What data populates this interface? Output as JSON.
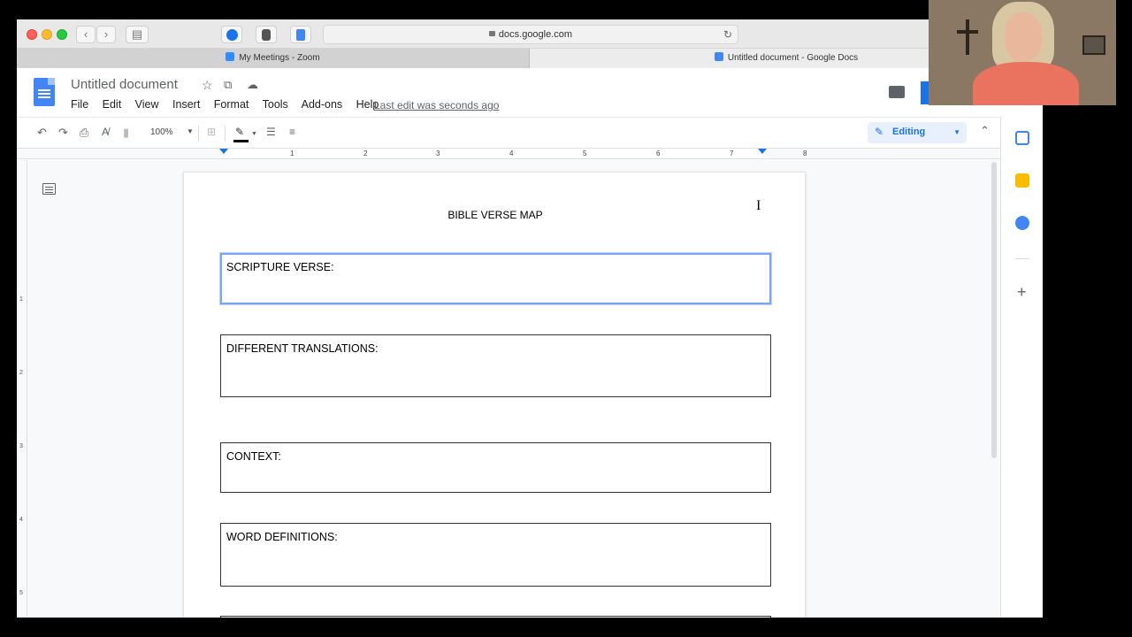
{
  "browser": {
    "url": "docs.google.com",
    "tabs": [
      {
        "label": "My Meetings - Zoom"
      },
      {
        "label": "Untitled document - Google Docs"
      }
    ]
  },
  "docs": {
    "title": "Untitled document",
    "menu": [
      "File",
      "Edit",
      "View",
      "Insert",
      "Format",
      "Tools",
      "Add-ons",
      "Help"
    ],
    "last_edit": "Last edit was seconds ago",
    "zoom": "100%",
    "mode": "Editing",
    "ruler_numbers": [
      "1",
      "2",
      "3",
      "4",
      "5",
      "6",
      "7",
      "8"
    ],
    "vruler_numbers": [
      "1",
      "2",
      "3",
      "4",
      "5"
    ]
  },
  "document": {
    "heading": "BIBLE VERSE MAP",
    "boxes": [
      {
        "label": "SCRIPTURE VERSE:"
      },
      {
        "label": "DIFFERENT TRANSLATIONS:"
      },
      {
        "label": "CONTEXT:"
      },
      {
        "label": "WORD DEFINITIONS:"
      }
    ]
  },
  "icons": {
    "back": "chevron-left-icon",
    "forward": "chevron-right-icon",
    "sidebar": "sidebar-icon",
    "reload": "reload-icon",
    "star": "star-icon",
    "move": "folder-icon",
    "cloud": "cloud-icon",
    "comments": "comment-icon",
    "outline": "outline-icon"
  },
  "colors": {
    "docs_blue": "#4285f4",
    "editing_accent": "#1a73e8",
    "selection_border": "#7aa7ef"
  }
}
